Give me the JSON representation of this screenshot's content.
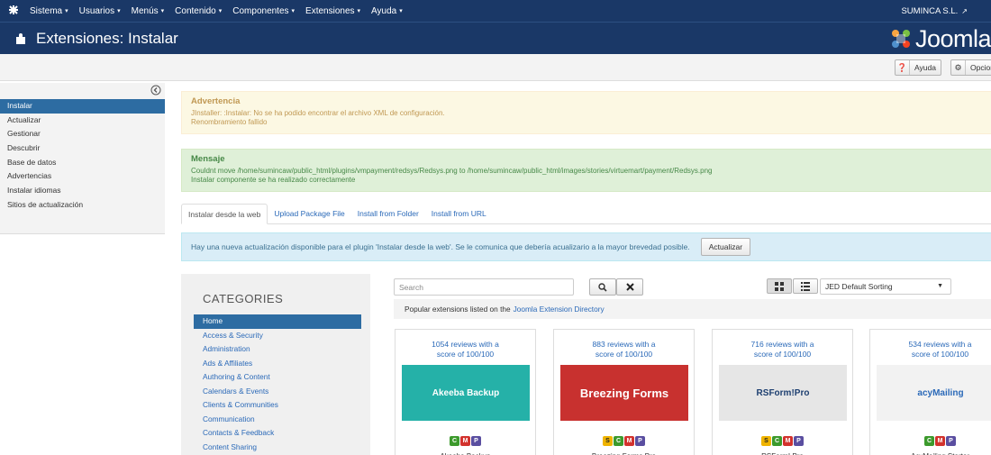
{
  "topbar": {
    "menu": [
      {
        "label": "Sistema",
        "caret": true
      },
      {
        "label": "Usuarios",
        "caret": true
      },
      {
        "label": "Menús",
        "caret": true
      },
      {
        "label": "Contenido",
        "caret": true
      },
      {
        "label": "Componentes",
        "caret": true
      },
      {
        "label": "Extensiones",
        "caret": true
      },
      {
        "label": "Ayuda",
        "caret": true
      }
    ],
    "user": "SUMINCA S.L."
  },
  "titlebar": {
    "title": "Extensiones: Instalar",
    "logo_text": "Joomla"
  },
  "toolbar": {
    "help_label": "Ayuda",
    "options_label": "Opciones"
  },
  "sidebar": {
    "items": [
      {
        "label": "Instalar",
        "active": true
      },
      {
        "label": "Actualizar"
      },
      {
        "label": "Gestionar"
      },
      {
        "label": "Descubrir"
      },
      {
        "label": "Base de datos"
      },
      {
        "label": "Advertencias"
      },
      {
        "label": "Instalar idiomas"
      },
      {
        "label": "Sitios de actualización"
      }
    ]
  },
  "alerts": {
    "warning": {
      "heading": "Advertencia",
      "lines": [
        "JInstaller: :Instalar: No se ha podido encontrar el archivo XML de configuración.",
        "Renombramiento fallido"
      ]
    },
    "message": {
      "heading": "Mensaje",
      "lines": [
        "Couldnt move /home/sumincaw/public_html/plugins/vmpayment/redsys/Redsys.png to /home/sumincaw/public_html/images/stories/virtuemart/payment/Redsys.png",
        "Instalar componente se ha realizado correctamente"
      ]
    }
  },
  "tabs": [
    {
      "label": "Instalar desde la web",
      "active": true
    },
    {
      "label": "Upload Package File"
    },
    {
      "label": "Install from Folder"
    },
    {
      "label": "Install from URL"
    }
  ],
  "update_notice": {
    "text": "Hay una nueva actualización disponible para el plugin 'Instalar desde la web'. Se le comunica que debería acualizario a la mayor brevedad posible.",
    "button": "Actualizar"
  },
  "categories": {
    "heading": "CATEGORIES",
    "items": [
      {
        "label": "Home",
        "active": true
      },
      {
        "label": "Access & Security"
      },
      {
        "label": "Administration"
      },
      {
        "label": "Ads & Affiliates"
      },
      {
        "label": "Authoring & Content"
      },
      {
        "label": "Calendars & Events"
      },
      {
        "label": "Clients & Communities"
      },
      {
        "label": "Communication"
      },
      {
        "label": "Contacts & Feedback"
      },
      {
        "label": "Content Sharing"
      }
    ]
  },
  "search": {
    "placeholder": "Search"
  },
  "sort": {
    "selected": "JED Default Sorting"
  },
  "popular": {
    "text": "Popular extensions listed on the",
    "link": "Joomla Extension Directory"
  },
  "extensions": [
    {
      "reviews_line1": "1054 reviews with a",
      "reviews_line2": "score of 100/100",
      "banner_text": "Akeeba Backup",
      "banner_color": "#25b1a8",
      "badges": [
        "C",
        "M",
        "P"
      ],
      "name": "Akeeba Backup"
    },
    {
      "reviews_line1": "883 reviews with a",
      "reviews_line2": "score of 100/100",
      "banner_text": "Breezing Forms",
      "banner_color": "#c8312f",
      "badges": [
        "S",
        "C",
        "M",
        "P"
      ],
      "name": "Breezing Forms Pro"
    },
    {
      "reviews_line1": "716 reviews with a",
      "reviews_line2": "score of 100/100",
      "banner_text": "RSForm!Pro",
      "banner_color": "#e6e6e6",
      "badges": [
        "S",
        "C",
        "M",
        "P"
      ],
      "name": "RSForm! Pro"
    },
    {
      "reviews_line1": "534 reviews with a",
      "reviews_line2": "score of 100/100",
      "banner_text": "acyMailing",
      "banner_color": "#f2f2f2",
      "badges": [
        "C",
        "M",
        "P"
      ],
      "name": "AcyMailing Starter"
    }
  ]
}
